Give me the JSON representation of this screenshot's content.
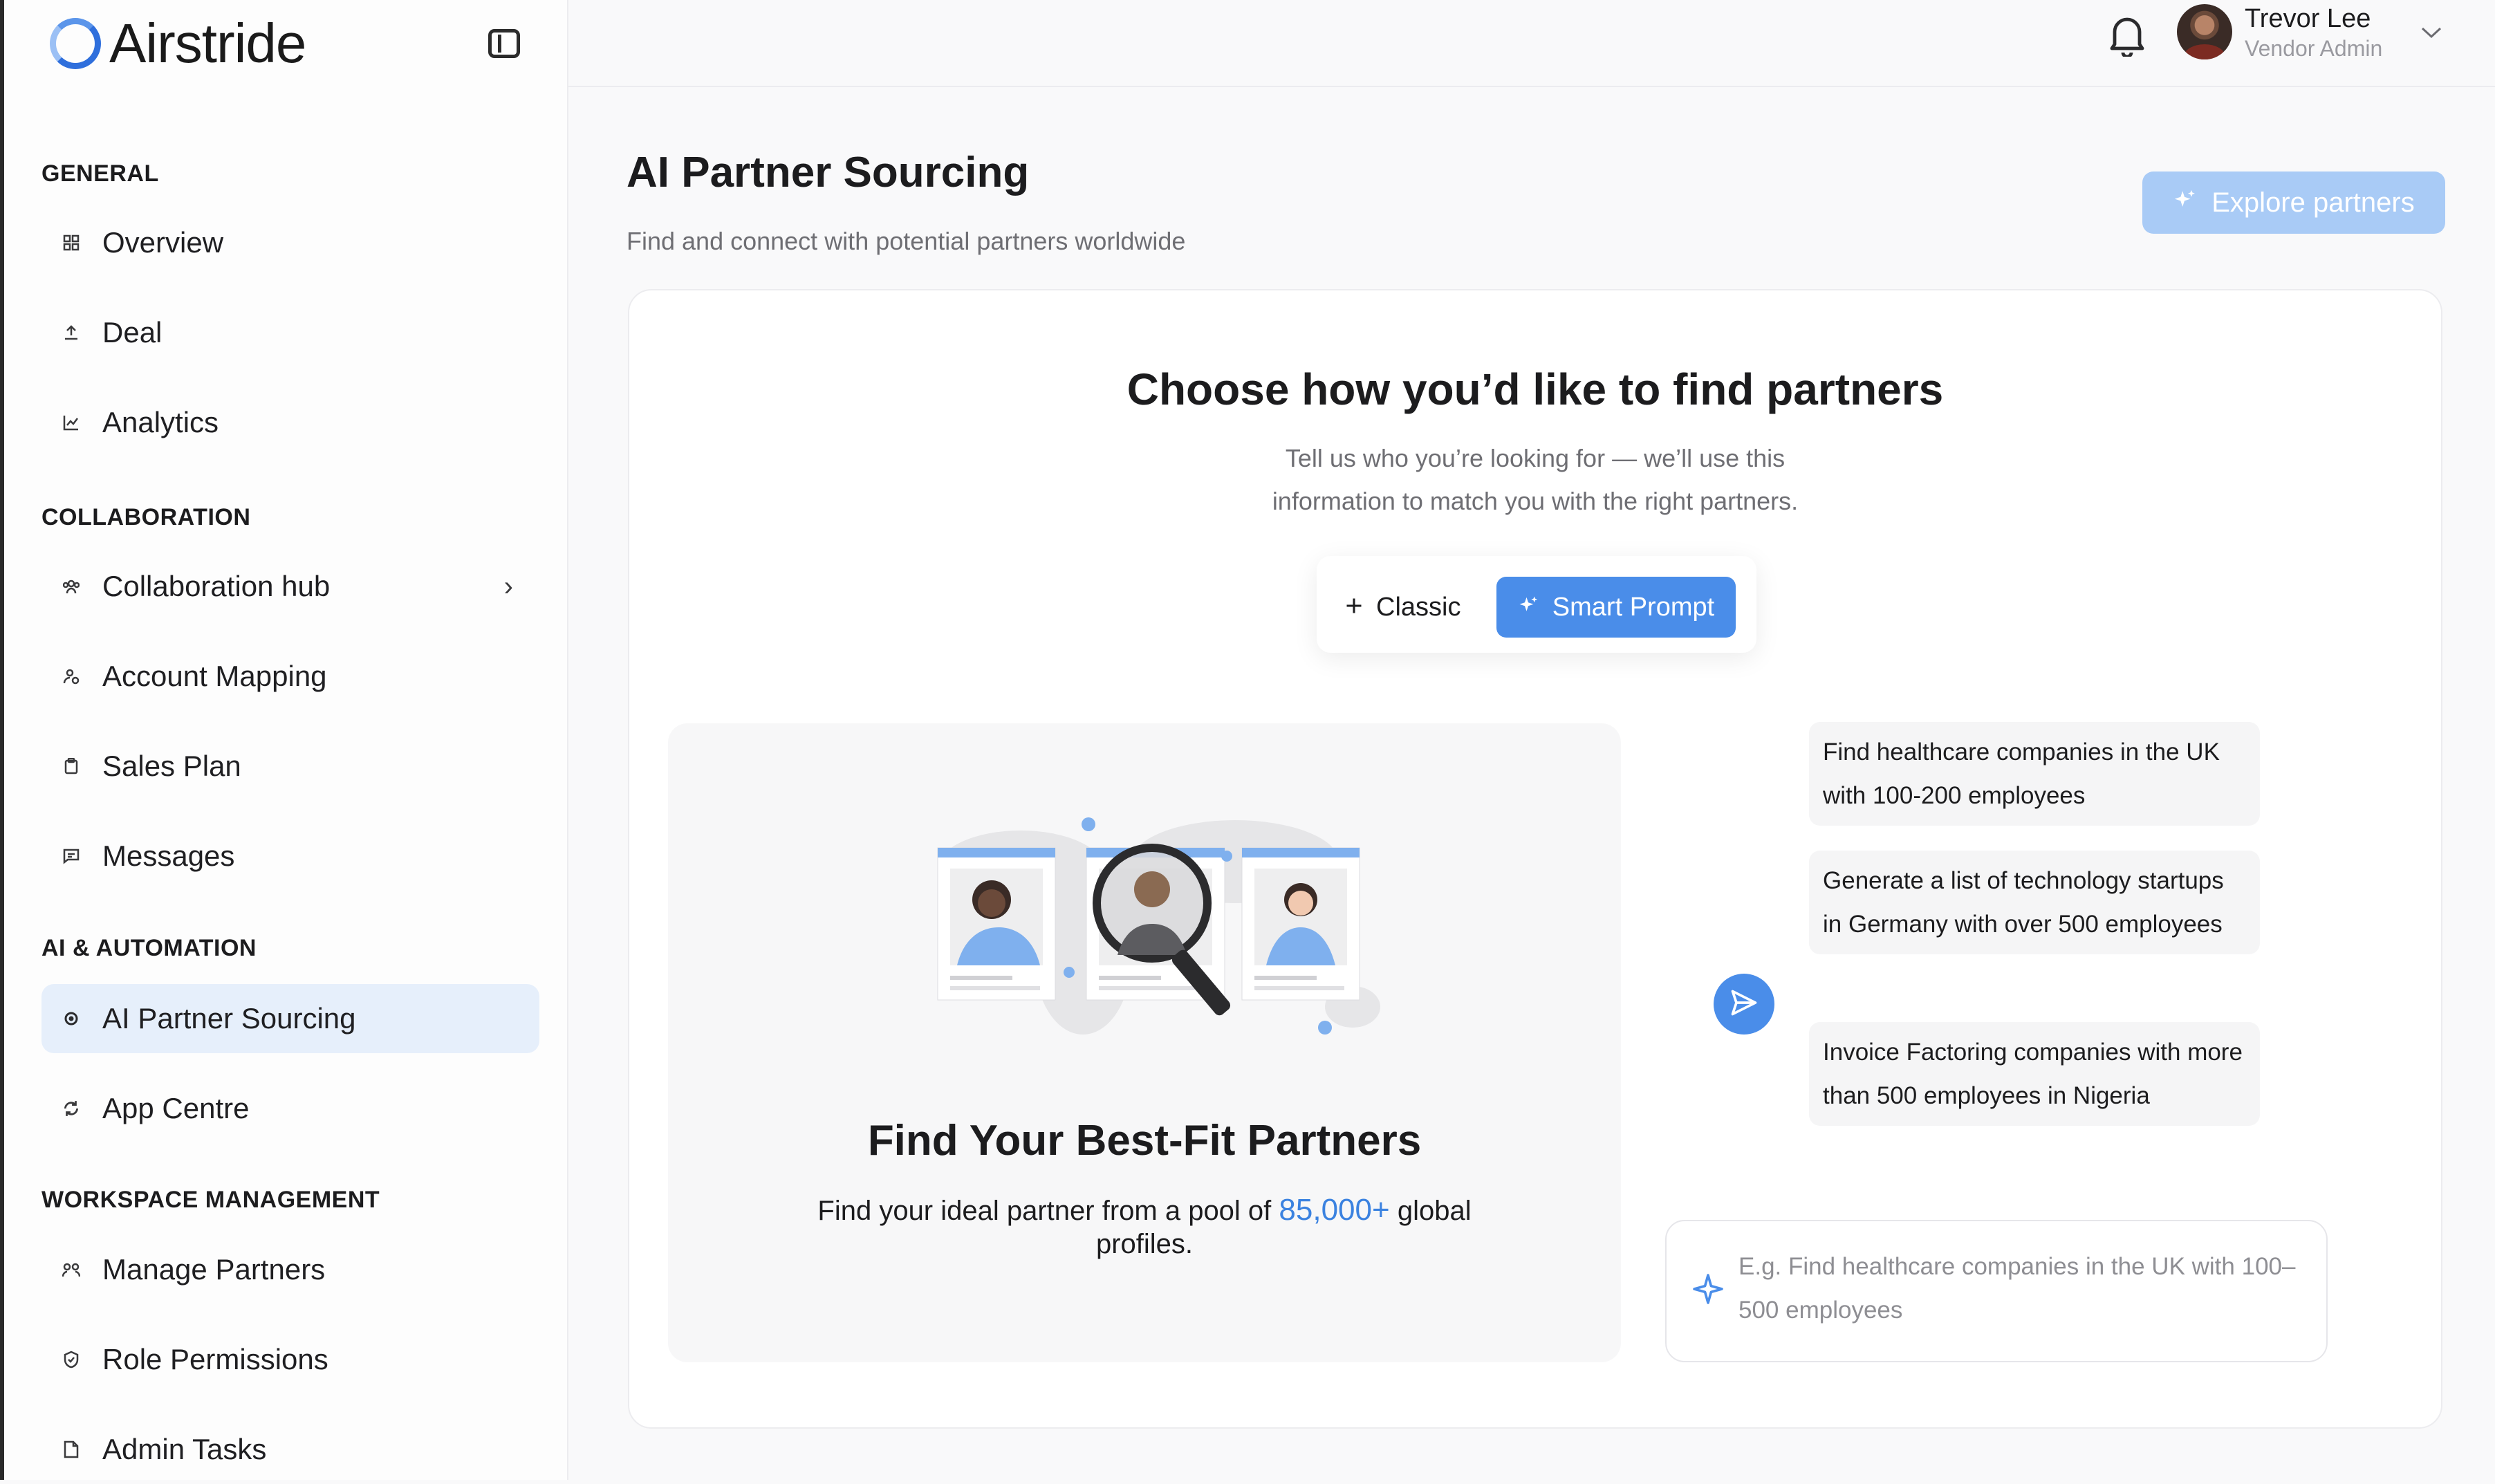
{
  "brand": {
    "name": "Airstride"
  },
  "sidebar": {
    "sections": [
      {
        "title": "GENERAL"
      },
      {
        "title": "COLLABORATION"
      },
      {
        "title": "AI & AUTOMATION"
      },
      {
        "title": "WORKSPACE MANAGEMENT"
      }
    ],
    "items": [
      {
        "label": "Overview",
        "icon": "grid-icon"
      },
      {
        "label": "Deal",
        "icon": "upload-icon"
      },
      {
        "label": "Analytics",
        "icon": "chart-icon"
      },
      {
        "label": "Collaboration hub",
        "icon": "team-icon"
      },
      {
        "label": "Account Mapping",
        "icon": "user-map-icon"
      },
      {
        "label": "Sales Plan",
        "icon": "clipboard-icon"
      },
      {
        "label": "Messages",
        "icon": "message-icon"
      },
      {
        "label": "AI Partner Sourcing",
        "icon": "gear-icon",
        "active": true
      },
      {
        "label": "App Centre",
        "icon": "refresh-icon"
      },
      {
        "label": "Manage Partners",
        "icon": "partners-icon"
      },
      {
        "label": "Role Permissions",
        "icon": "shield-icon"
      },
      {
        "label": "Admin Tasks",
        "icon": "file-icon"
      }
    ]
  },
  "user": {
    "name": "Trevor Lee",
    "role": "Vendor Admin"
  },
  "page": {
    "title": "AI Partner Sourcing",
    "subtitle": "Find and connect with potential partners worldwide",
    "explore_label": "Explore partners"
  },
  "finder": {
    "title": "Choose how you’d like to find partners",
    "description": "Tell us who you’re looking for — we’ll use this information to match you with the right partners.",
    "mode_classic": "Classic",
    "mode_smart": "Smart Prompt"
  },
  "illustration": {
    "title": "Find Your Best-Fit Partners",
    "desc_before": "Find your ideal partner from a pool of",
    "highlight": "85,000+",
    "desc_after": "global profiles."
  },
  "suggestions": [
    "Find healthcare companies in the UK with 100-200 employees",
    "Generate a list of technology startups in Germany with over 500 employees",
    "Invoice Factoring companies with more than 500 employees in Nigeria"
  ],
  "prompt": {
    "placeholder": "E.g. Find healthcare companies in the UK with 100–500 employees"
  },
  "colors": {
    "accent": "#4a8de9",
    "active_bg": "#e6effb",
    "highlight": "#3b82e0"
  }
}
